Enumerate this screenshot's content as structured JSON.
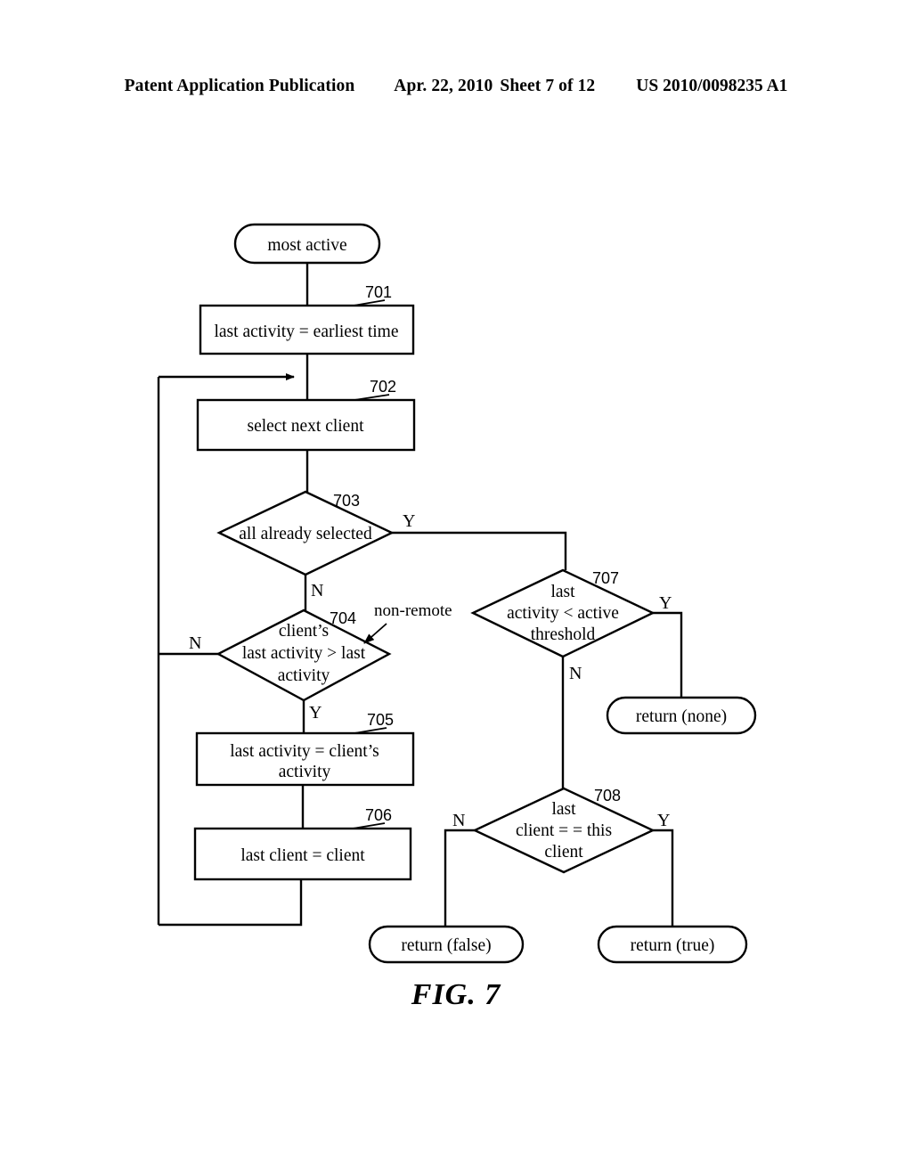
{
  "header": {
    "publication": "Patent Application Publication",
    "date": "Apr. 22, 2010",
    "sheet": "Sheet 7 of 12",
    "patent_number": "US 2010/0098235 A1"
  },
  "figure": {
    "caption": "FIG. 7",
    "title": "most active"
  },
  "nodes": {
    "start": {
      "ref": "",
      "label": "most active",
      "shape": "terminator"
    },
    "n701": {
      "ref": "701",
      "label": "last activity = earliest time",
      "shape": "process"
    },
    "n702": {
      "ref": "702",
      "label": "select next client",
      "shape": "process"
    },
    "n703": {
      "ref": "703",
      "label": "all already selected",
      "shape": "decision"
    },
    "n704": {
      "ref": "704",
      "line1": "client’s",
      "line2": "last activity > last",
      "line3": "activity",
      "shape": "decision"
    },
    "n705": {
      "ref": "705",
      "line1": "last activity = client’s",
      "line2": "activity",
      "shape": "process"
    },
    "n706": {
      "ref": "706",
      "label": "last client = client",
      "shape": "process"
    },
    "n707": {
      "ref": "707",
      "line1": "last",
      "line2": "activity < active",
      "line3": "threshold",
      "shape": "decision"
    },
    "n708": {
      "ref": "708",
      "line1": "last",
      "line2": "client = = this",
      "line3": "client",
      "shape": "decision"
    },
    "return_none": {
      "ref": "",
      "label": "return (none)",
      "shape": "terminator"
    },
    "return_false": {
      "ref": "",
      "label": "return (false)",
      "shape": "terminator"
    },
    "return_true": {
      "ref": "",
      "label": "return (true)",
      "shape": "terminator"
    }
  },
  "branch_labels": {
    "b703_yes": "Y",
    "b703_no": "N",
    "b704_no": "N",
    "b704_yes": "Y",
    "b707_yes": "Y",
    "b707_no": "N",
    "b708_no": "N",
    "b708_yes": "Y"
  },
  "annotations": {
    "non_remote": "non-remote"
  },
  "colors": {
    "ink": "#000000",
    "paper": "#ffffff"
  }
}
